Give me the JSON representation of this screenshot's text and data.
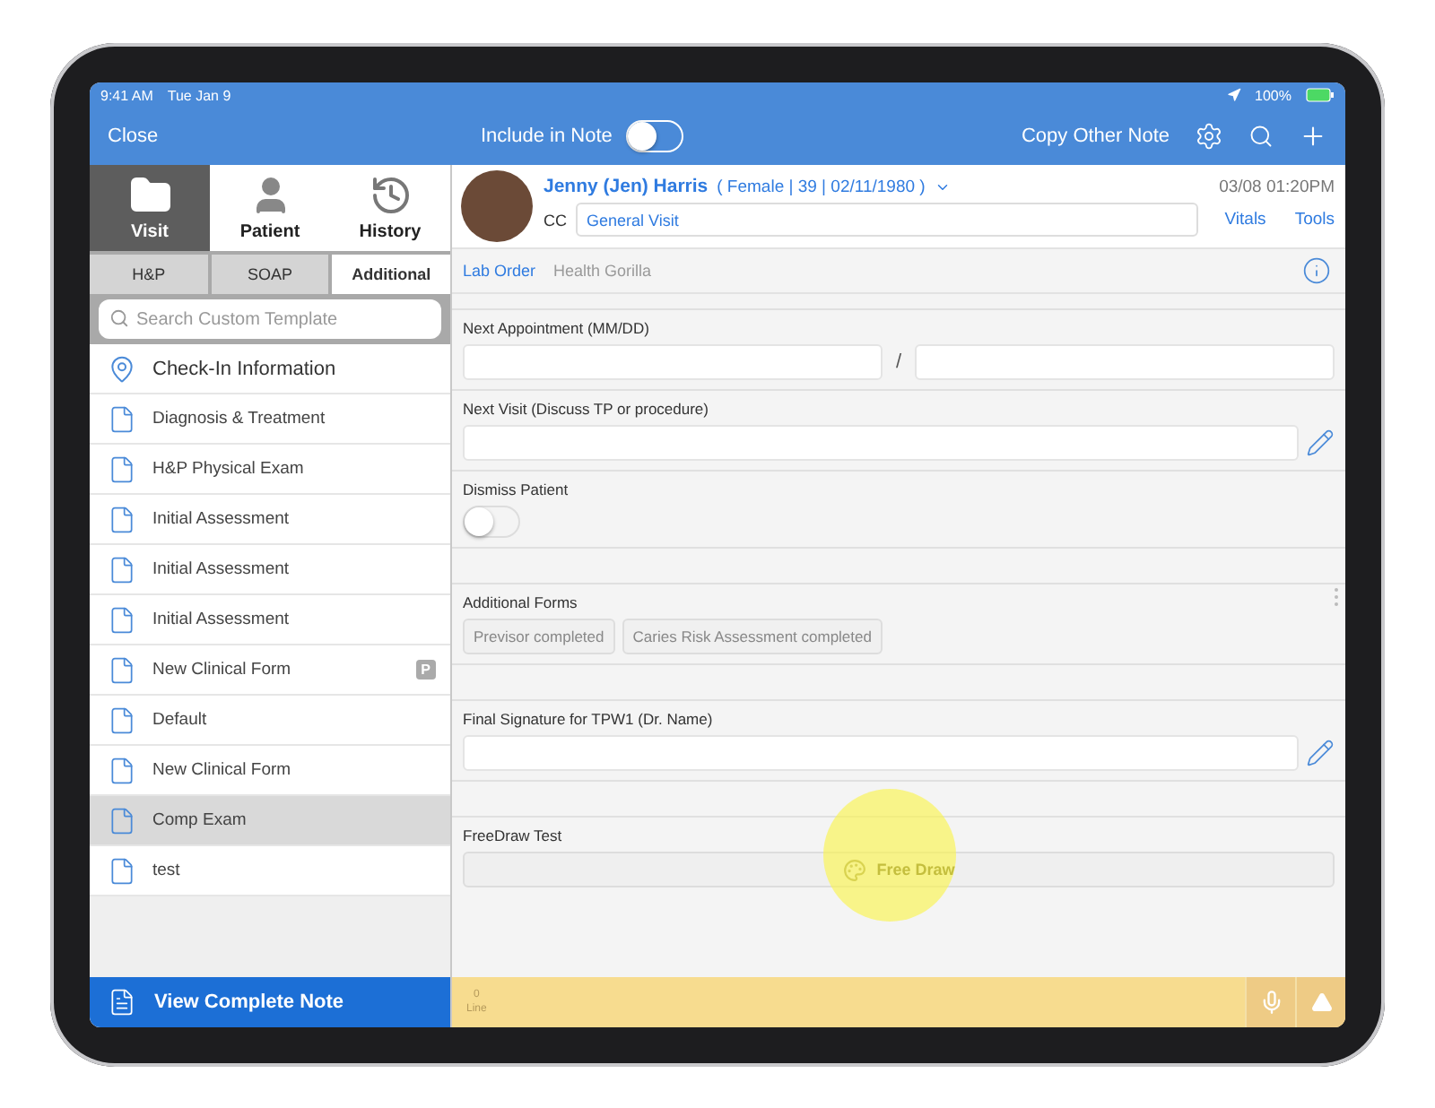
{
  "status_bar": {
    "time": "9:41 AM",
    "date": "Tue Jan 9",
    "battery": "100%"
  },
  "nav_bar": {
    "close": "Close",
    "include_in_note": {
      "label": "Include in Note",
      "on": false
    },
    "copy_other_note": "Copy Other Note"
  },
  "top_tabs": [
    {
      "label": "Visit",
      "kind": "folder",
      "selected": true
    },
    {
      "label": "Patient",
      "kind": "person",
      "selected": false
    },
    {
      "label": "History",
      "kind": "history",
      "selected": false
    }
  ],
  "sub_tabs": [
    {
      "label": "H&P",
      "selected": false
    },
    {
      "label": "SOAP",
      "selected": false
    },
    {
      "label": "Additional",
      "selected": true
    }
  ],
  "search": {
    "placeholder": "Search Custom Template"
  },
  "templates": [
    {
      "label": "Check-In Information",
      "kind": "location",
      "selected": false
    },
    {
      "label": "Diagnosis & Treatment",
      "kind": "document",
      "selected": false
    },
    {
      "label": "H&P Physical Exam",
      "kind": "document",
      "selected": false
    },
    {
      "label": "Initial Assessment",
      "kind": "document",
      "selected": false
    },
    {
      "label": "Initial Assessment",
      "kind": "document",
      "selected": false
    },
    {
      "label": "Initial Assessment",
      "kind": "document",
      "selected": false
    },
    {
      "label": "New Clinical Form",
      "kind": "document",
      "selected": false,
      "badge": "P"
    },
    {
      "label": "Default",
      "kind": "document",
      "selected": false
    },
    {
      "label": "New Clinical Form",
      "kind": "document",
      "selected": false
    },
    {
      "label": "Comp Exam",
      "kind": "document",
      "selected": true
    },
    {
      "label": "test",
      "kind": "document",
      "selected": false
    }
  ],
  "view_complete_note": "View Complete Note",
  "patient": {
    "name": "Jenny (Jen) Harris",
    "details": "( Female | 39 | 02/11/1980 )",
    "visit_time": "03/08 01:20PM",
    "cc_label": "CC",
    "cc_value": "General Visit",
    "links": [
      "Vitals",
      "Tools"
    ]
  },
  "lab_row": [
    {
      "label": "Lab Order",
      "disabled": false
    },
    {
      "label": "Health Gorilla",
      "disabled": true
    }
  ],
  "sections": [
    {
      "kind": "date",
      "label": "Next Appointment (MM/DD)",
      "separator": "/"
    },
    {
      "kind": "text",
      "label": "Next Visit (Discuss TP or procedure)"
    },
    {
      "kind": "toggle",
      "label": "Dismiss Patient",
      "on": false
    },
    {
      "kind": "spacer"
    },
    {
      "kind": "chips",
      "label": "Additional Forms",
      "chips": [
        "Previsor completed",
        "Caries Risk Assessment completed"
      ]
    },
    {
      "kind": "spacer"
    },
    {
      "kind": "text",
      "label": "Final Signature for TPW1 (Dr. Name)"
    },
    {
      "kind": "spacer"
    },
    {
      "kind": "draw",
      "label": "FreeDraw Test",
      "button": "Free Draw"
    }
  ],
  "dictation_bar": {
    "count": "0",
    "unit": "Line"
  }
}
